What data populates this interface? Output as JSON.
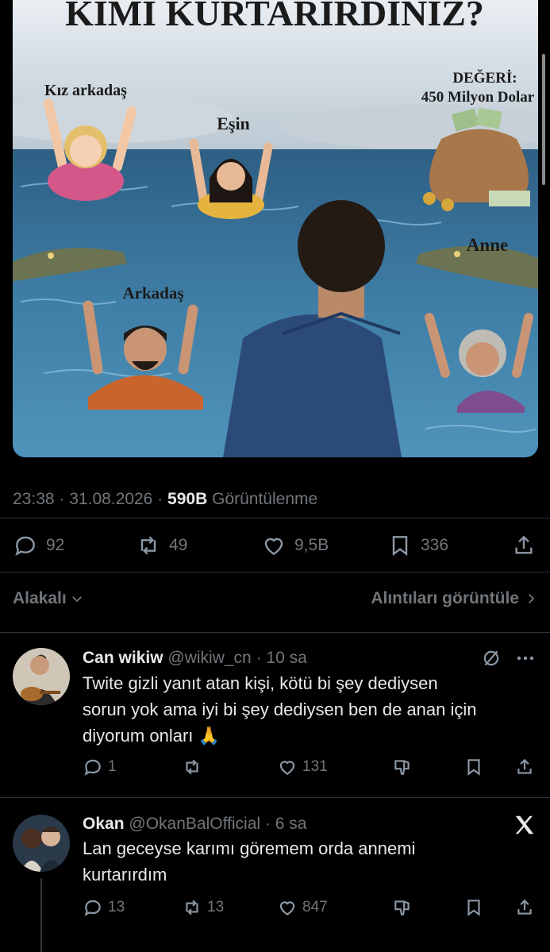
{
  "image": {
    "title": "KİMİ KURTARIRDINIZ?",
    "labels": {
      "girlfriend": "Kız arkadaş",
      "spouse": "Eşin",
      "value_line1": "DEĞERİ:",
      "value_line2": "450 Milyon Dolar",
      "friend": "Arkadaş",
      "mother": "Anne"
    }
  },
  "meta": {
    "time": "23:38",
    "date": "31.08.2026",
    "views": "590B",
    "views_label": "Görüntülenme",
    "sep": "·"
  },
  "actions": {
    "replies": "92",
    "reposts": "49",
    "likes": "9,5B",
    "bookmarks": "336"
  },
  "sort": {
    "left": "Alakalı",
    "right": "Alıntıları görüntüle"
  },
  "replies": [
    {
      "name": "Can wikiw",
      "handle": "@wikiw_cn",
      "time": "10 sa",
      "text_lines": [
        "Twite gizli yanıt atan kişi, kötü bi şey dediysen",
        "sorun yok ama iyi bi şey dediysen ben de anan için",
        "diyorum onları 🙏"
      ],
      "replies": "1",
      "reposts": "",
      "likes": "131"
    },
    {
      "name": "Okan",
      "handle": "@OkanBalOfficial",
      "time": "6 sa",
      "text_lines": [
        "Lan geceyse karımı göremem orda annemi",
        "kurtarırdım"
      ],
      "replies": "13",
      "reposts": "13",
      "likes": "847"
    }
  ],
  "colors": {
    "background": "#000000",
    "secondary_text": "#71767b",
    "divider": "#2f3336",
    "water": "#3f7ea6"
  }
}
